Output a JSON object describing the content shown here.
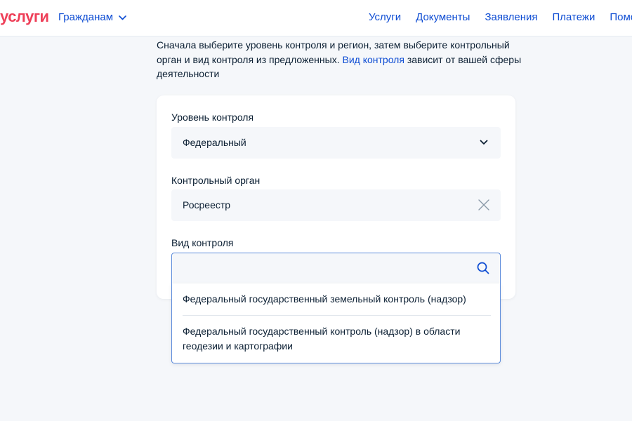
{
  "header": {
    "logo": "услуги",
    "audience_label": "Гражданам",
    "nav": [
      "Услуги",
      "Документы",
      "Заявления",
      "Платежи",
      "Помощь"
    ]
  },
  "intro": {
    "text_before": "Сначала выберите уровень контроля и регион, затем выберите контрольный орган и вид контроля из предложенных. ",
    "link": "Вид контроля",
    "text_after": " зависит от вашей сферы деятельности"
  },
  "form": {
    "level": {
      "label": "Уровень контроля",
      "value": "Федеральный",
      "icon": "chevron-down-icon"
    },
    "authority": {
      "label": "Контрольный орган",
      "value": "Росреестр",
      "icon": "close-icon"
    },
    "control_type": {
      "label": "Вид контроля",
      "value": "",
      "icon": "search-icon",
      "options": [
        "Федеральный государственный земельный контроль (надзор)",
        "Федеральный государственный контроль (надзор) в области геодезии и картографии"
      ]
    }
  },
  "colors": {
    "brand_red": "#ee3f58",
    "link_blue": "#0d4cd3",
    "text": "#0b1f33",
    "page_bg": "#f5f7fa",
    "focus_border": "#5d8cdb"
  }
}
